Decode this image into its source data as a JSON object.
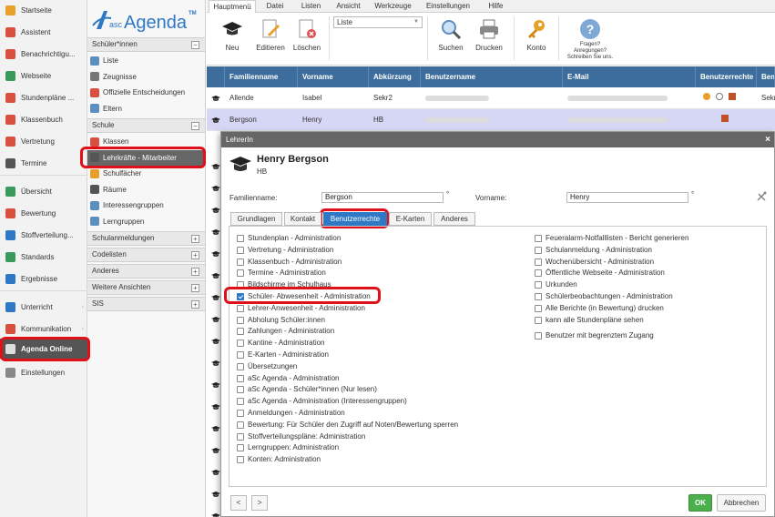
{
  "colors": {
    "accent": "#2e78c5",
    "header_blue": "#3c6d9c",
    "highlight_red": "#e0101a",
    "ok_green": "#4cae4c",
    "selected_row": "#d6d6f5"
  },
  "leftnav": {
    "items": [
      {
        "label": "Startseite",
        "icon": "home-icon",
        "color": "#e8a02a"
      },
      {
        "label": "Assistent",
        "icon": "wand-icon",
        "color": "#d9503f"
      },
      {
        "label": "Benachrichtigu...",
        "icon": "mail-icon",
        "color": "#d9503f"
      },
      {
        "label": "Webseite",
        "icon": "globe-icon",
        "color": "#3a9a5b"
      },
      {
        "label": "Stundenpläne ...",
        "icon": "timetable-icon",
        "color": "#d9503f"
      },
      {
        "label": "Klassenbuch",
        "icon": "book-icon",
        "color": "#d9503f"
      },
      {
        "label": "Vertretung",
        "icon": "substitution-icon",
        "color": "#d9503f"
      },
      {
        "label": "Termine",
        "icon": "calendar-icon",
        "color": "#555555"
      },
      {
        "label": "Übersicht",
        "icon": "check-circle-icon",
        "color": "#3a9a5b"
      },
      {
        "label": "Bewertung",
        "icon": "grade-icon",
        "color": "#d9503f"
      },
      {
        "label": "Stoffverteilung...",
        "icon": "curriculum-icon",
        "color": "#2e78c5"
      },
      {
        "label": "Standards",
        "icon": "shield-icon",
        "color": "#3a9a5b"
      },
      {
        "label": "Ergebnisse",
        "icon": "chart-icon",
        "color": "#2e78c5"
      },
      {
        "label": "Unterricht",
        "icon": "class-icon",
        "color": "#2e78c5"
      },
      {
        "label": "Kommunikation",
        "icon": "chat-icon",
        "color": "#d9503f"
      },
      {
        "label": "Agenda Online",
        "icon": "agenda-icon",
        "color": "#dddddd"
      },
      {
        "label": "Einstellungen",
        "icon": "gear-icon",
        "color": "#888888"
      }
    ]
  },
  "subnav": {
    "logo_text": "Agenda",
    "logo_prefix": "asc",
    "logo_tm": "TM",
    "sections": {
      "schueler": "Schüler*innen",
      "schule": "Schule",
      "schulanmeldungen": "Schulanmeldungen",
      "codelisten": "Codelisten",
      "anderes": "Anderes",
      "weitere": "Weitere Ansichten",
      "sis": "SIS"
    },
    "schueler_items": [
      "Liste",
      "Zeugnisse",
      "Offizielle Entscheidungen",
      "Eltern"
    ],
    "schule_items": [
      "Klassen",
      "Lehrkräfte - Mitarbeiter",
      "Schulfächer",
      "Räume",
      "Interessengruppen",
      "Lerngruppen"
    ]
  },
  "ribbon": {
    "tabs": [
      "Hauptmenü",
      "Datei",
      "Listen",
      "Ansicht",
      "Werkzeuge",
      "Einstellungen",
      "Hilfe"
    ],
    "buttons": {
      "neu": "Neu",
      "editieren": "Editieren",
      "loeschen": "Löschen",
      "suchen": "Suchen",
      "drucken": "Drucken",
      "konto": "Konto",
      "fragen": "Fragen? Anregungen? Schreiben Sie uns."
    },
    "list_select": "Liste"
  },
  "grid": {
    "columns": [
      "Familienname",
      "Vorname",
      "Abkürzung",
      "Benutzername",
      "E-Mail",
      "Benutzerrechte",
      "Bem"
    ],
    "rows": [
      {
        "familienname": "Allende",
        "vorname": "Isabel",
        "abkuerzung": "Sekr2",
        "extra": "Sekr"
      },
      {
        "familienname": "Bergson",
        "vorname": "Henry",
        "abkuerzung": "HB",
        "extra": ""
      }
    ]
  },
  "dialog": {
    "title": "LehrerIn",
    "close": "×",
    "name": "Henry Bergson",
    "abbr": "HB",
    "familienname_label": "Familienname:",
    "familienname_value": "Bergson",
    "vorname_label": "Vorname:",
    "vorname_value": "Henry",
    "degree": "°",
    "tabs": [
      "Grundlagen",
      "Kontakt",
      "Benutzerrechte",
      "E-Karten",
      "Anderes"
    ],
    "permissions_left": [
      {
        "label": "Stundenplan - Administration",
        "checked": false
      },
      {
        "label": "Vertretung - Administration",
        "checked": false
      },
      {
        "label": "Klassenbuch - Administration",
        "checked": false
      },
      {
        "label": "Termine - Administration",
        "checked": false
      },
      {
        "label": "Bildschirme im Schulhaus",
        "checked": false
      },
      {
        "label": "Schüler- Abwesenheit - Administration",
        "checked": true
      },
      {
        "label": "Lehrer-Anwesenheit - Administration",
        "checked": false
      },
      {
        "label": "Abholung Schüler:innen",
        "checked": false
      },
      {
        "label": "Zahlungen - Administration",
        "checked": false
      },
      {
        "label": "Kantine - Administration",
        "checked": false
      },
      {
        "label": "E-Karten - Administration",
        "checked": false
      },
      {
        "label": "Übersetzungen",
        "checked": false
      },
      {
        "label": "aSc Agenda - Administration",
        "checked": false
      },
      {
        "label": "aSc Agenda - Schüler*innen (Nur lesen)",
        "checked": false
      },
      {
        "label": "aSc Agenda - Administration (Interessengruppen)",
        "checked": false
      },
      {
        "label": "Anmeldungen - Administration",
        "checked": false
      },
      {
        "label": "Bewertung: Für Schüler den Zugriff auf Noten/Bewertung sperren",
        "checked": false
      },
      {
        "label": "Stoffverteilungspläne: Administration",
        "checked": false
      },
      {
        "label": "Lerngruppen: Administration",
        "checked": false
      },
      {
        "label": "Konten: Administration",
        "checked": false
      }
    ],
    "permissions_right": [
      {
        "label": "Feueralarm-Notfalllisten - Bericht generieren",
        "checked": false
      },
      {
        "label": "Schulanmeldung - Administration",
        "checked": false
      },
      {
        "label": "Wochenübersicht - Administration",
        "checked": false
      },
      {
        "label": "Öffentliche Webseite - Administration",
        "checked": false
      },
      {
        "label": "Urkunden",
        "checked": false
      },
      {
        "label": "Schülerbeobachtungen - Administration",
        "checked": false
      },
      {
        "label": "Alle Berichte (in Bewertung) drucken",
        "checked": false
      },
      {
        "label": "kann alle Stundenpläne sehen",
        "checked": false
      }
    ],
    "limited_access": "Benutzer mit begrenztem Zugang",
    "prev": "<",
    "next": ">",
    "ok": "OK",
    "cancel": "Abbrechen"
  }
}
